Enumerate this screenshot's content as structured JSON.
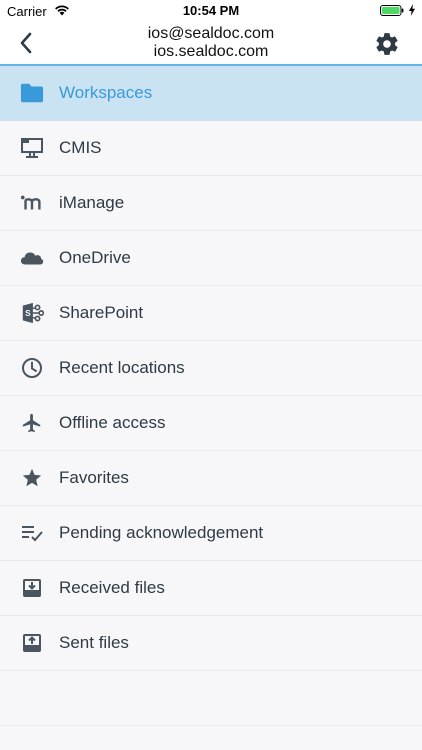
{
  "status_bar": {
    "carrier": "Carrier",
    "time": "10:54 PM",
    "icons": [
      "wifi-icon",
      "battery-icon",
      "charging-bolt-icon"
    ]
  },
  "nav": {
    "back_icon": "chevron-left-icon",
    "title_line1": "ios@sealdoc.com",
    "title_line2": "ios.sealdoc.com",
    "settings_icon": "gear-icon"
  },
  "colors": {
    "accent": "#3a9ad9",
    "selected_bg": "#c9e3f2",
    "nav_border": "#63b4e4",
    "text": "#2f3a45",
    "icon": "#4a5560"
  },
  "menu": {
    "items": [
      {
        "label": "Workspaces",
        "icon": "folder-icon",
        "selected": true
      },
      {
        "label": "CMIS",
        "icon": "cmis-icon",
        "selected": false
      },
      {
        "label": "iManage",
        "icon": "imanage-icon",
        "selected": false
      },
      {
        "label": "OneDrive",
        "icon": "cloud-icon",
        "selected": false
      },
      {
        "label": "SharePoint",
        "icon": "sharepoint-icon",
        "selected": false
      },
      {
        "label": "Recent locations",
        "icon": "clock-icon",
        "selected": false
      },
      {
        "label": "Offline access",
        "icon": "airplane-icon",
        "selected": false
      },
      {
        "label": "Favorites",
        "icon": "star-icon",
        "selected": false
      },
      {
        "label": "Pending acknowledgement",
        "icon": "checklist-icon",
        "selected": false
      },
      {
        "label": "Received files",
        "icon": "inbox-download-icon",
        "selected": false
      },
      {
        "label": "Sent files",
        "icon": "inbox-upload-icon",
        "selected": false
      }
    ]
  }
}
